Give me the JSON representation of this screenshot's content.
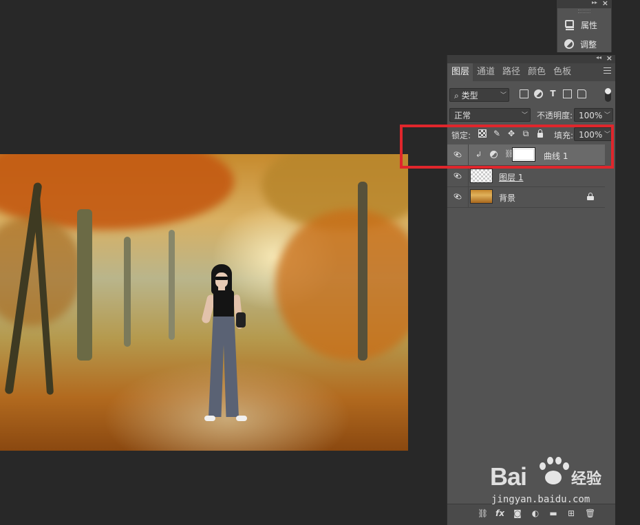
{
  "mini_panel": {
    "items": [
      {
        "label": "属性",
        "icon": "properties-icon"
      },
      {
        "label": "调整",
        "icon": "adjustments-icon"
      }
    ]
  },
  "layers_panel": {
    "tabs": [
      {
        "label": "图层",
        "active": true
      },
      {
        "label": "通道",
        "active": false
      },
      {
        "label": "路径",
        "active": false
      },
      {
        "label": "颜色",
        "active": false
      },
      {
        "label": "色板",
        "active": false
      }
    ],
    "filter": {
      "label": "类型"
    },
    "blend_mode": "正常",
    "opacity_label": "不透明度:",
    "opacity_value": "100%",
    "lock_label": "锁定:",
    "fill_label": "填充:",
    "fill_value": "100%",
    "layers": [
      {
        "name": "曲线 1",
        "type": "adjustment-curves",
        "selected": true,
        "visible": true
      },
      {
        "name": "图层 1",
        "type": "pixel",
        "selected": false,
        "visible": true
      },
      {
        "name": "背景",
        "type": "background",
        "selected": false,
        "visible": true,
        "locked": true
      }
    ]
  },
  "watermark": {
    "brand": "Bai",
    "brand_suffix": "经验",
    "url": "jingyan.baidu.com"
  },
  "colors": {
    "workspace": "#282828",
    "panel": "#535353",
    "selected_layer": "#6a6a6a",
    "highlight": "#e0262c"
  }
}
